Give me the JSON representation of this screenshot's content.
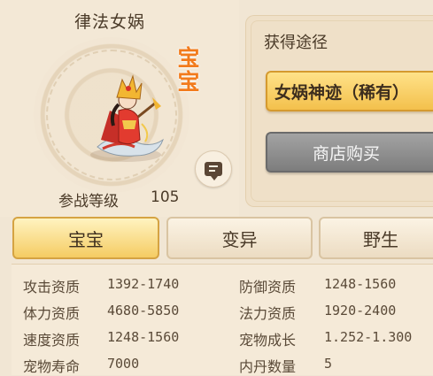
{
  "pet": {
    "name": "律法女娲",
    "type_badge": "宝宝",
    "level_label": "参战等级",
    "level_value": "105"
  },
  "source": {
    "title": "获得途径",
    "rare_button": "女娲神迹（稀有）",
    "shop_button": "商店购买"
  },
  "tabs": [
    {
      "label": "宝宝",
      "active": true
    },
    {
      "label": "变异",
      "active": false
    },
    {
      "label": "野生",
      "active": false
    }
  ],
  "stats": {
    "left": [
      {
        "label": "攻击资质",
        "value": "1392-1740"
      },
      {
        "label": "体力资质",
        "value": "4680-5850"
      },
      {
        "label": "速度资质",
        "value": "1248-1560"
      },
      {
        "label": "宠物寿命",
        "value": "7000"
      }
    ],
    "right": [
      {
        "label": "防御资质",
        "value": "1248-1560"
      },
      {
        "label": "法力资质",
        "value": "1920-2400"
      },
      {
        "label": "宠物成长",
        "value": "1.252-1.300"
      },
      {
        "label": "内丹数量",
        "value": "5"
      }
    ]
  },
  "colors": {
    "badge": "#f27b1c",
    "tab_active": "#f5cc63",
    "rare_button": "#f3c04c",
    "shop_button": "#8c8c8c"
  }
}
